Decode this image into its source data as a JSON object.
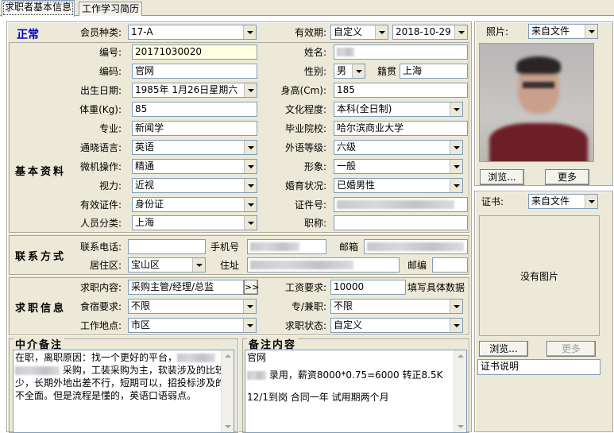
{
  "tabs": [
    {
      "label": "求职者基本信息"
    },
    {
      "label": "工作学习简历"
    }
  ],
  "status": "正常",
  "header": {
    "member_type_label": "会员种类:",
    "member_type": "17-A",
    "validity_label": "有效期:",
    "validity_mode": "自定义",
    "validity_date": "2018-10-29"
  },
  "sections": {
    "basic": "基本资料",
    "contact": "联系方式",
    "jobseek": "求职信息"
  },
  "basic": {
    "number_label": "编号:",
    "number": "20171030020",
    "name_label": "姓名:",
    "code_label": "编码:",
    "code": "官网",
    "gender_label": "性别:",
    "gender": "男",
    "native_label": "籍贯",
    "native": "上海",
    "birth_label": "出生日期:",
    "birth": "1985年 1月26日星期六",
    "height_label": "身高(Cm):",
    "height": "185",
    "weight_label": "体重(Kg):",
    "weight": "85",
    "edu_label": "文化程度:",
    "edu": "本科(全日制)",
    "major_label": "专业:",
    "major": "新闻学",
    "school_label": "毕业院校:",
    "school": "哈尔滨商业大学",
    "lang_label": "通晓语言:",
    "lang": "英语",
    "lang_level_label": "外语等级:",
    "lang_level": "六级",
    "pc_label": "微机操作:",
    "pc": "精通",
    "image_label": "形象:",
    "image": "一般",
    "vision_label": "视力:",
    "vision": "近视",
    "marital_label": "婚育状况:",
    "marital": "已婚男性",
    "idtype_label": "有效证件:",
    "idtype": "身份证",
    "idnum_label": "证件号:",
    "category_label": "人员分类:",
    "category": "上海",
    "title_label": "职称:"
  },
  "contact": {
    "phone_label": "联系电话:",
    "mobile_label": "手机号",
    "email_label": "邮箱",
    "area_label": "居住区:",
    "area": "宝山区",
    "addr_label": "住址",
    "zip_label": "邮编"
  },
  "job": {
    "content_label": "求职内容:",
    "content": "采购主管/经理/总监",
    "more_btn": ">>",
    "salary_label": "工资要求:",
    "salary": "10000",
    "salary_note": "填写具体数据",
    "board_label": "食宿要求:",
    "board": "不限",
    "fulltime_label": "专/兼职:",
    "fulltime": "不限",
    "place_label": "工作地点:",
    "place": "市区",
    "state_label": "求职状态:",
    "state": "自定义"
  },
  "photo": {
    "label": "照片:",
    "source": "来自文件",
    "browse": "浏览...",
    "more": "更多"
  },
  "cert": {
    "label": "证书:",
    "source": "来自文件",
    "no_image": "没有图片",
    "browse": "浏览...",
    "more": "更多",
    "desc": "证书说明"
  },
  "notes": {
    "agent_title": "中介备注",
    "agent_text_a": "在职，离职原因：找一个更好的平台，",
    "agent_text_b": "采购，工装采购为主，软装涉及的比较少，长期外地出差不行，短期可以，招投标涉及的不全面。但是流程是懂的，英语口语弱点。",
    "remark_title": "备注内容",
    "remark_line1": "官网",
    "remark_line2": "录用，薪资8000*0.75=6000 转正8.5K",
    "remark_line3": "12/1到岗    合同一年 试用期两个月"
  }
}
